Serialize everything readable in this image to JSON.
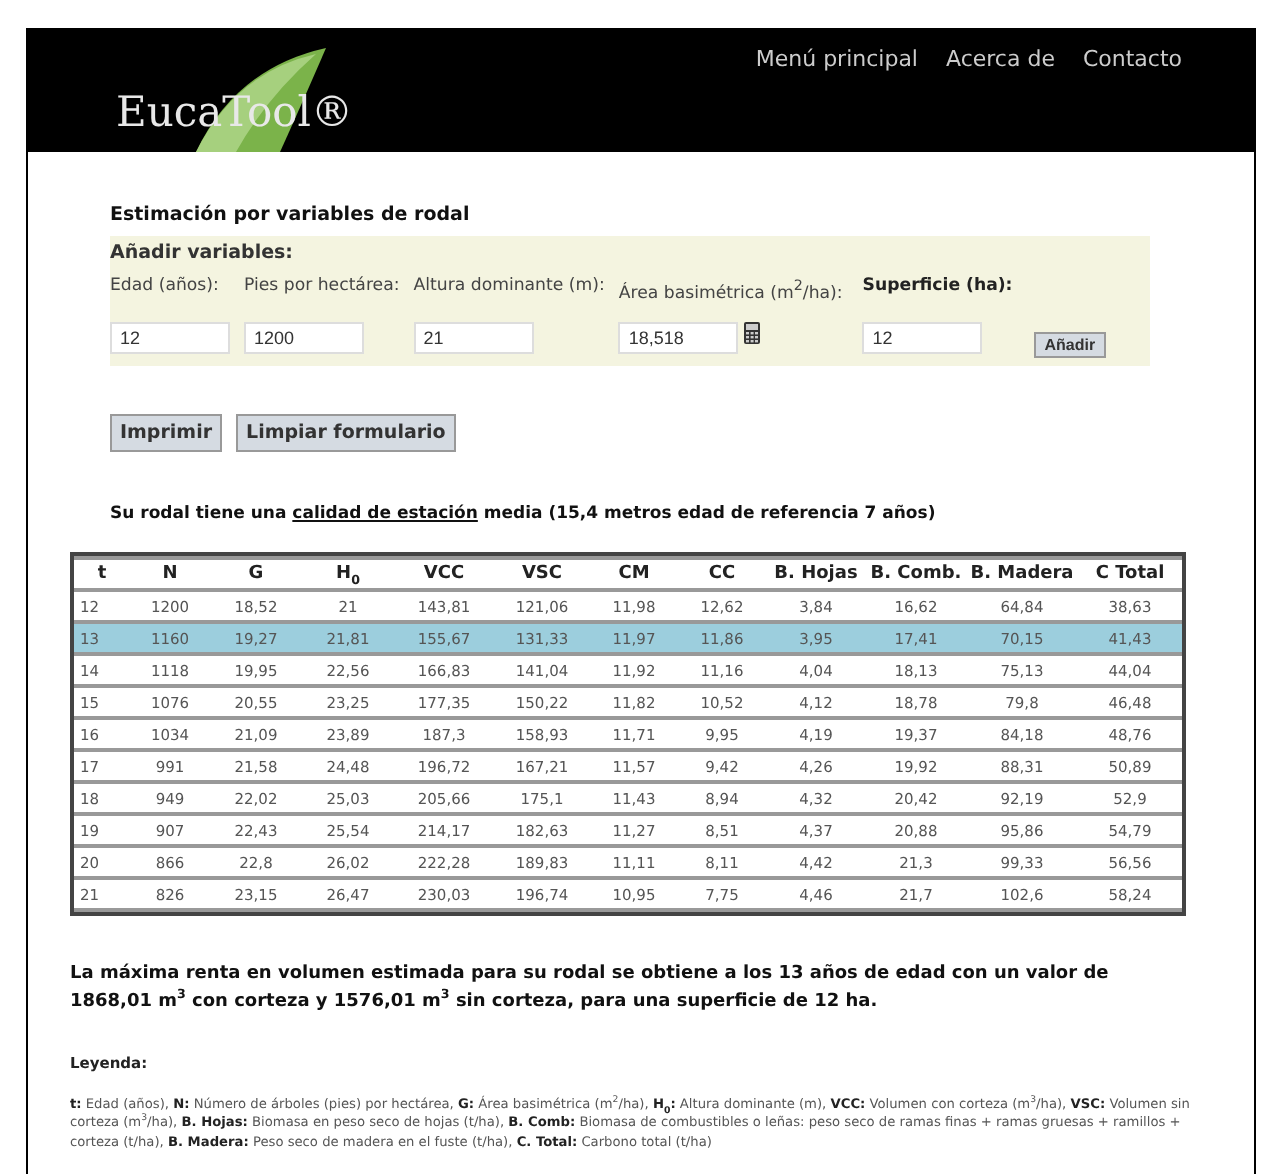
{
  "header": {
    "logo": "EucaTool®",
    "nav": [
      {
        "label": "Menú principal"
      },
      {
        "label": "Acerca de"
      },
      {
        "label": "Contacto"
      }
    ]
  },
  "form": {
    "title": "Estimación por variables de rodal",
    "section": "Añadir variables:",
    "fields": [
      {
        "label": "Edad (años):",
        "value": "12",
        "bold": false,
        "calculator": false
      },
      {
        "label": "Pies por hectárea:",
        "value": "1200",
        "bold": false,
        "calculator": false
      },
      {
        "label": "Altura dominante (m):",
        "value": "21",
        "bold": false,
        "calculator": false
      },
      {
        "label": "Área basimétrica (m$^{2}$/ha):",
        "value": "18,518",
        "bold": false,
        "calculator": true
      },
      {
        "label": "Superficie (ha):",
        "value": "12",
        "bold": true,
        "calculator": false
      }
    ],
    "add_button": "Añadir"
  },
  "actions": [
    "Imprimir",
    "Limpiar formulario"
  ],
  "quality": {
    "before": "Su rodal tiene una",
    "link": "calidad de estación",
    "after": "media (15,4 metros edad de referencia 7 años)"
  },
  "table": {
    "columns": [
      "t",
      "N",
      "G",
      "H$_{0}$",
      "VCC",
      "VSC",
      "CM",
      "CC",
      "B. Hojas",
      "B. Comb.",
      "B. Madera",
      "C Total"
    ],
    "rows": [
      {
        "cells": [
          "12",
          "1200",
          "18,52",
          "21",
          "143,81",
          "121,06",
          "11,98",
          "12,62",
          "3,84",
          "16,62",
          "64,84",
          "38,63"
        ],
        "selected": false
      },
      {
        "cells": [
          "13",
          "1160",
          "19,27",
          "21,81",
          "155,67",
          "131,33",
          "11,97",
          "11,86",
          "3,95",
          "17,41",
          "70,15",
          "41,43"
        ],
        "selected": true
      },
      {
        "cells": [
          "14",
          "1118",
          "19,95",
          "22,56",
          "166,83",
          "141,04",
          "11,92",
          "11,16",
          "4,04",
          "18,13",
          "75,13",
          "44,04"
        ],
        "selected": false
      },
      {
        "cells": [
          "15",
          "1076",
          "20,55",
          "23,25",
          "177,35",
          "150,22",
          "11,82",
          "10,52",
          "4,12",
          "18,78",
          "79,8",
          "46,48"
        ],
        "selected": false
      },
      {
        "cells": [
          "16",
          "1034",
          "21,09",
          "23,89",
          "187,3",
          "158,93",
          "11,71",
          "9,95",
          "4,19",
          "19,37",
          "84,18",
          "48,76"
        ],
        "selected": false
      },
      {
        "cells": [
          "17",
          "991",
          "21,58",
          "24,48",
          "196,72",
          "167,21",
          "11,57",
          "9,42",
          "4,26",
          "19,92",
          "88,31",
          "50,89"
        ],
        "selected": false
      },
      {
        "cells": [
          "18",
          "949",
          "22,02",
          "25,03",
          "205,66",
          "175,1",
          "11,43",
          "8,94",
          "4,32",
          "20,42",
          "92,19",
          "52,9"
        ],
        "selected": false
      },
      {
        "cells": [
          "19",
          "907",
          "22,43",
          "25,54",
          "214,17",
          "182,63",
          "11,27",
          "8,51",
          "4,37",
          "20,88",
          "95,86",
          "54,79"
        ],
        "selected": false
      },
      {
        "cells": [
          "20",
          "866",
          "22,8",
          "26,02",
          "222,28",
          "189,83",
          "11,11",
          "8,11",
          "4,42",
          "21,3",
          "99,33",
          "56,56"
        ],
        "selected": false
      },
      {
        "cells": [
          "21",
          "826",
          "23,15",
          "26,47",
          "230,03",
          "196,74",
          "10,95",
          "7,75",
          "4,46",
          "21,7",
          "102,6",
          "58,24"
        ],
        "selected": false
      }
    ]
  },
  "summary": "La máxima renta en volumen estimada para su rodal se obtiene a los 13 años de edad con un valor de 1868,01 m$^{3}$ con corteza y 1576,01 m$^{3}$ sin corteza, para una superficie de 12 ha.",
  "legend": {
    "title": "Leyenda:",
    "text": "**t:** Edad (años), **N:** Número de árboles (pies) por hectárea, **G:** Área basimétrica (m$^{2}$/ha), **H$_{0}$:** Altura dominante (m), **VCC:** Volumen con corteza (m$^{3}$/ha), **VSC:** Volumen sin corteza (m$^{3}$/ha), **B. Hojas:** Biomasa en peso seco de hojas (t/ha), **B. Comb:** Biomasa de combustibles o leñas: peso seco de ramas finas + ramas gruesas + ramillos + corteza (t/ha), **B. Madera:** Peso seco de madera en el fuste (t/ha), **C. Total:** Carbono total (t/ha)"
  }
}
